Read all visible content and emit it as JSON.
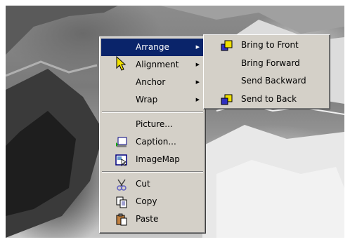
{
  "main_menu": {
    "items": [
      {
        "label": "Arrange",
        "selected": true,
        "has_submenu": true
      },
      {
        "label": "Alignment",
        "has_submenu": true
      },
      {
        "label": "Anchor",
        "has_submenu": true
      },
      {
        "label": "Wrap",
        "has_submenu": true
      },
      {
        "label": "Picture..."
      },
      {
        "label": "Caption...",
        "icon": "caption-icon"
      },
      {
        "label": "ImageMap",
        "icon": "imagemap-icon"
      },
      {
        "label": "Cut",
        "icon": "scissors-icon"
      },
      {
        "label": "Copy",
        "icon": "copy-icon"
      },
      {
        "label": "Paste",
        "icon": "paste-icon"
      }
    ]
  },
  "arrange_submenu": {
    "items": [
      {
        "label": "Bring to Front",
        "icon": "bring-to-front-icon"
      },
      {
        "label": "Bring Forward"
      },
      {
        "label": "Send Backward"
      },
      {
        "label": "Send to Back",
        "icon": "send-to-back-icon"
      }
    ]
  },
  "colors": {
    "menu_bg": "#d4d0c8",
    "highlight": "#0a246a"
  }
}
